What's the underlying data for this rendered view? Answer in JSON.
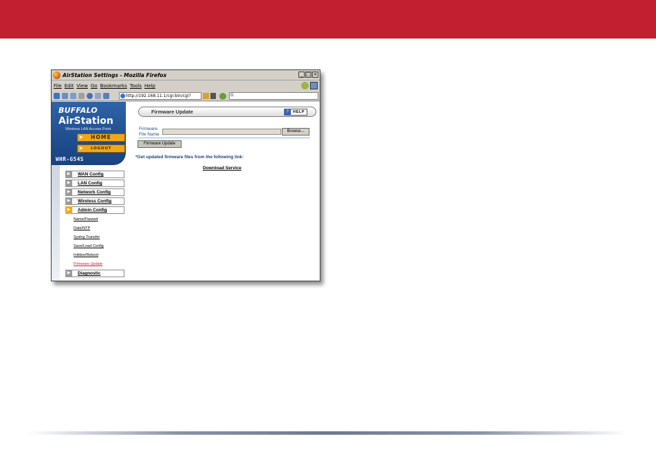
{
  "window": {
    "title": "AirStation Settings - Mozilla Firefox",
    "controls": [
      "_",
      "□",
      "×"
    ]
  },
  "browser": {
    "menu": [
      "File",
      "Edit",
      "View",
      "Go",
      "Bookmarks",
      "Tools",
      "Help"
    ],
    "url": "http://192.168.11.1/cgi-bin/cgi?",
    "search_placeholder": ""
  },
  "brand": {
    "logo": "BUFFALO",
    "product": "AirStation",
    "tagline": "Wireless LAN Access Point",
    "home": "HOME",
    "logout": "LOGOUT",
    "model": "WHR-G54S"
  },
  "nav": {
    "items": [
      {
        "label": "WAN Config"
      },
      {
        "label": "LAN Config"
      },
      {
        "label": "Network Config"
      },
      {
        "label": "Wireless Config"
      },
      {
        "label": "Admin Config"
      },
      {
        "label": "Diagnostic"
      }
    ],
    "subitems": [
      {
        "label": "Name/Passwd"
      },
      {
        "label": "Date/NTP"
      },
      {
        "label": "Syslog Transfer"
      },
      {
        "label": "Save/Load Config"
      },
      {
        "label": "Initilize/Reboot"
      },
      {
        "label": "Firmware Update"
      }
    ]
  },
  "main": {
    "title": "Firmware Update",
    "help": "HELP",
    "field_label_1": "Firmware",
    "field_label_2": "File Name",
    "field_value": "",
    "browse": "Browse...",
    "submit": "Firmware Update",
    "note": "*Get updated firmware files from the following link:",
    "link": "Download Service"
  },
  "colors": {
    "banner": "#c21f30",
    "brand_blue": "#1f4e8e",
    "accent_orange": "#f3a718"
  }
}
